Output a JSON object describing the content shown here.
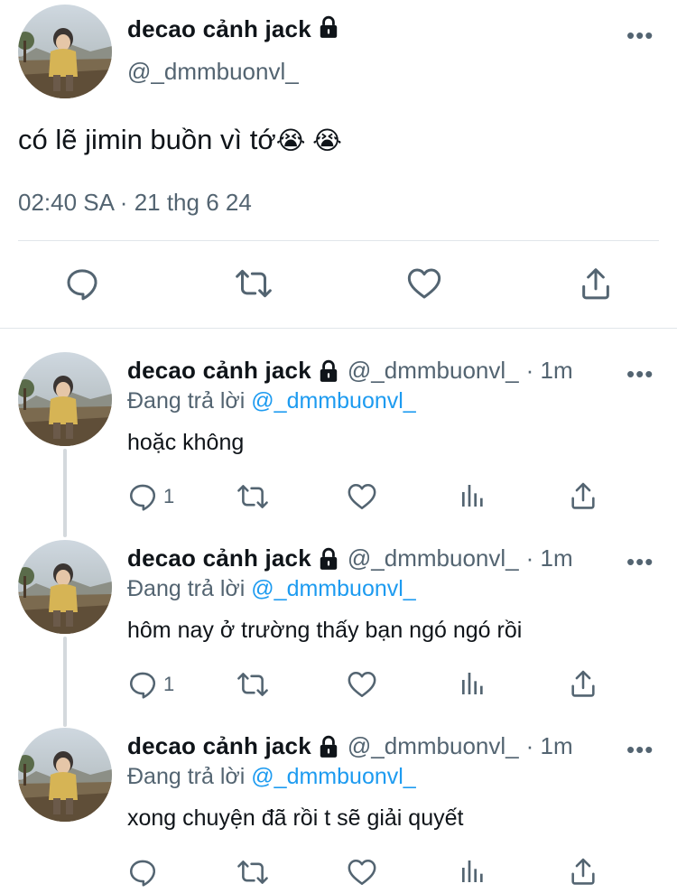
{
  "main_tweet": {
    "display_name": "decao cảnh jack",
    "handle": "@_dmmbuonvl_",
    "text": "có lẽ jimin buồn vì tớ",
    "emoji": "😭 😭",
    "time": "02:40 SA",
    "separator": "·",
    "date": "21 thg 6 24",
    "more_label": "•••",
    "actions": [
      "reply-icon",
      "retweet-icon",
      "like-icon",
      "share-icon"
    ]
  },
  "replies": [
    {
      "display_name": "decao cảnh jack",
      "handle": "@_dmmbuonvl_",
      "age": "· 1m",
      "replying_prefix": "Đang trả lời",
      "replying_to": "@_dmmbuonvl_",
      "text": "hoặc không",
      "reply_count": "1",
      "more_label": "•••"
    },
    {
      "display_name": "decao cảnh jack",
      "handle": "@_dmmbuonvl_",
      "age": "· 1m",
      "replying_prefix": "Đang trả lời",
      "replying_to": "@_dmmbuonvl_",
      "text": "hôm nay ở trường thấy bạn ngó ngó rồi",
      "reply_count": "1",
      "more_label": "•••"
    },
    {
      "display_name": "decao cảnh jack",
      "handle": "@_dmmbuonvl_",
      "age": "· 1m",
      "replying_prefix": "Đang trả lời",
      "replying_to": "@_dmmbuonvl_",
      "text": "xong chuyện đã rồi t sẽ giải quyết",
      "reply_count": "",
      "more_label": "•••"
    }
  ],
  "colors": {
    "text": "#0f1419",
    "muted": "#536471",
    "link": "#1d9bf0",
    "divider": "#e1e6ea"
  }
}
